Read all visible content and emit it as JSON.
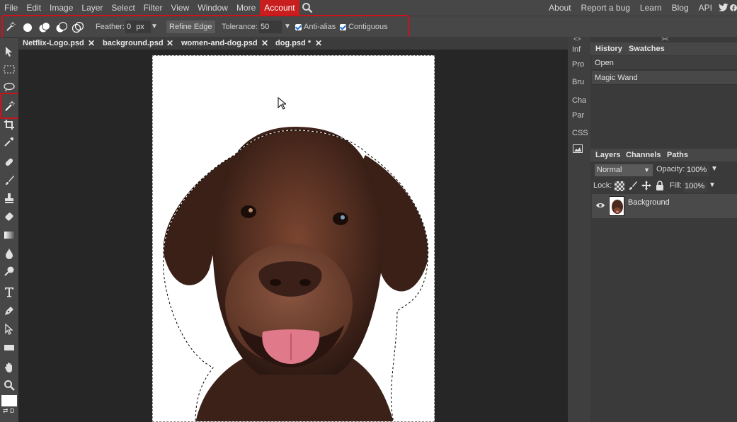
{
  "menu": {
    "items": [
      "File",
      "Edit",
      "Image",
      "Layer",
      "Select",
      "Filter",
      "View",
      "Window",
      "More",
      "Account"
    ],
    "right_items": [
      "About",
      "Report a bug",
      "Learn",
      "Blog",
      "API"
    ],
    "active": "Account",
    "accent": "#c81e1e"
  },
  "options": {
    "feather_label": "Feather:",
    "feather_value": "0",
    "feather_unit": "px",
    "refine_edge": "Refine Edge",
    "tolerance_label": "Tolerance:",
    "tolerance_value": "50",
    "anti_alias": "Anti-alias",
    "contiguous": "Contiguous",
    "highlight_color": "#d0101a"
  },
  "tabs": [
    {
      "label": "Netflix-Logo.psd"
    },
    {
      "label": "background.psd"
    },
    {
      "label": "women-and-dog.psd"
    },
    {
      "label": "dog.psd *"
    }
  ],
  "mini_panel": [
    "Inf",
    "Pro",
    "Bru",
    "Cha",
    "Par",
    "CSS"
  ],
  "history": {
    "tabs": [
      "History",
      "Swatches"
    ],
    "items": [
      "Open",
      "Magic Wand"
    ]
  },
  "layers": {
    "tabs": [
      "Layers",
      "Channels",
      "Paths"
    ],
    "blend_mode": "Normal",
    "opacity_label": "Opacity:",
    "opacity_value": "100%",
    "lock_label": "Lock:",
    "fill_label": "Fill:",
    "fill_value": "100%",
    "items": [
      {
        "name": "Background"
      }
    ]
  },
  "toolbar": {
    "icons": [
      "move-icon",
      "marquee-icon",
      "lasso-icon",
      "magic-wand-icon",
      "crop-icon",
      "eyedropper-icon",
      "healing-icon",
      "brush-icon",
      "stamp-icon",
      "eraser-icon",
      "gradient-icon",
      "blur-icon",
      "dodge-icon",
      "type-icon",
      "pen-icon",
      "path-select-icon",
      "shape-icon",
      "hand-icon",
      "zoom-icon"
    ],
    "active": "magic-wand-icon"
  }
}
